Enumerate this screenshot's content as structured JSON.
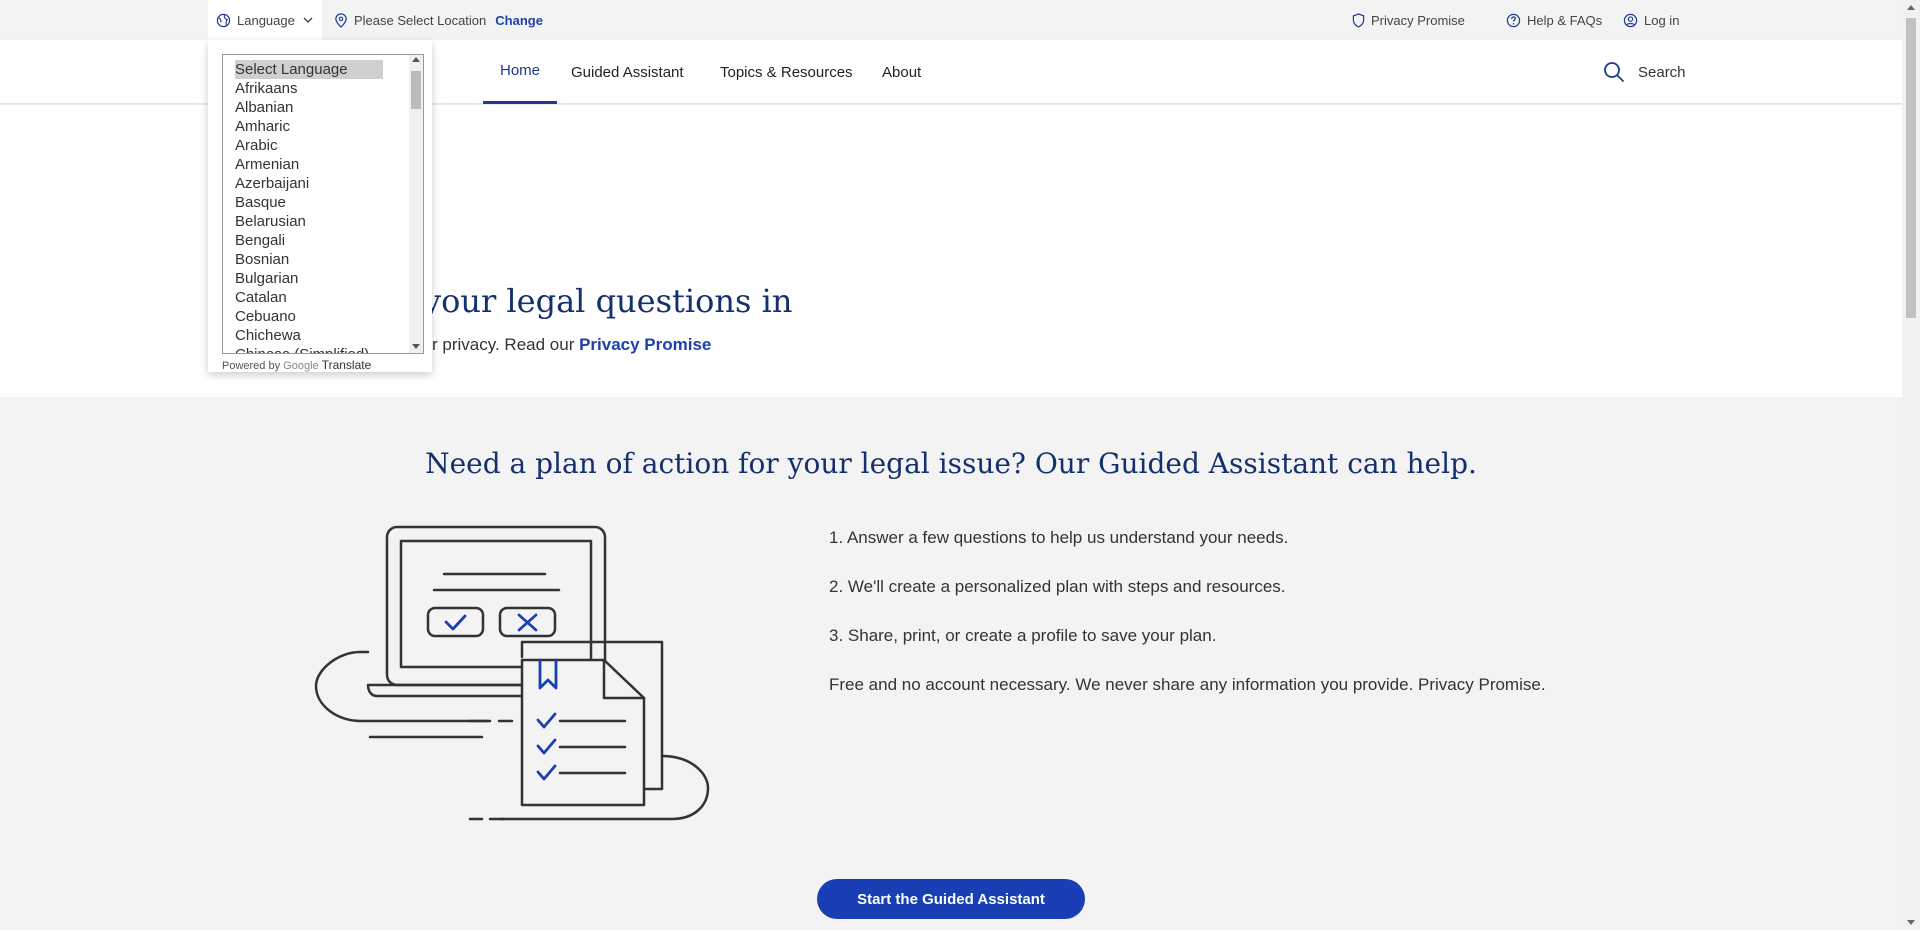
{
  "utility_bar": {
    "language_label": "Language",
    "location_label": "Please Select Location",
    "change_label": "Change",
    "privacy_label": "Privacy Promise",
    "help_label": "Help & FAQs",
    "login_label": "Log in"
  },
  "nav": {
    "items": [
      "Home",
      "Guided Assistant",
      "Topics & Resources",
      "About"
    ],
    "active": "Home",
    "search_label": "Search"
  },
  "hero": {
    "heading_visible": "your legal questions in",
    "sub_visible": "r privacy. Read our ",
    "privacy_link": "Privacy Promise"
  },
  "guided": {
    "title": "Need a plan of action for your legal issue? Our Guided Assistant can help.",
    "steps": [
      "1. Answer a few questions to help us understand your needs.",
      "2. We'll create a personalized plan with steps and resources.",
      "3. Share, print, or create a profile to save your plan.",
      "Free and no account necessary. We never share any information you provide. Privacy Promise."
    ],
    "cta_label": "Start the Guided Assistant"
  },
  "language_dropdown": {
    "options": [
      "Select Language",
      "Afrikaans",
      "Albanian",
      "Amharic",
      "Arabic",
      "Armenian",
      "Azerbaijani",
      "Basque",
      "Belarusian",
      "Bengali",
      "Bosnian",
      "Bulgarian",
      "Catalan",
      "Cebuano",
      "Chichewa",
      "Chinese (Simplified)"
    ],
    "selected": "Select Language",
    "powered_by": "Powered by",
    "google": "Google",
    "translate": "Translate"
  },
  "colors": {
    "brand_navy": "#14306f",
    "link_blue": "#1e40af",
    "cta_blue": "#1a3fb4",
    "check_blue": "#1a3fb4"
  }
}
